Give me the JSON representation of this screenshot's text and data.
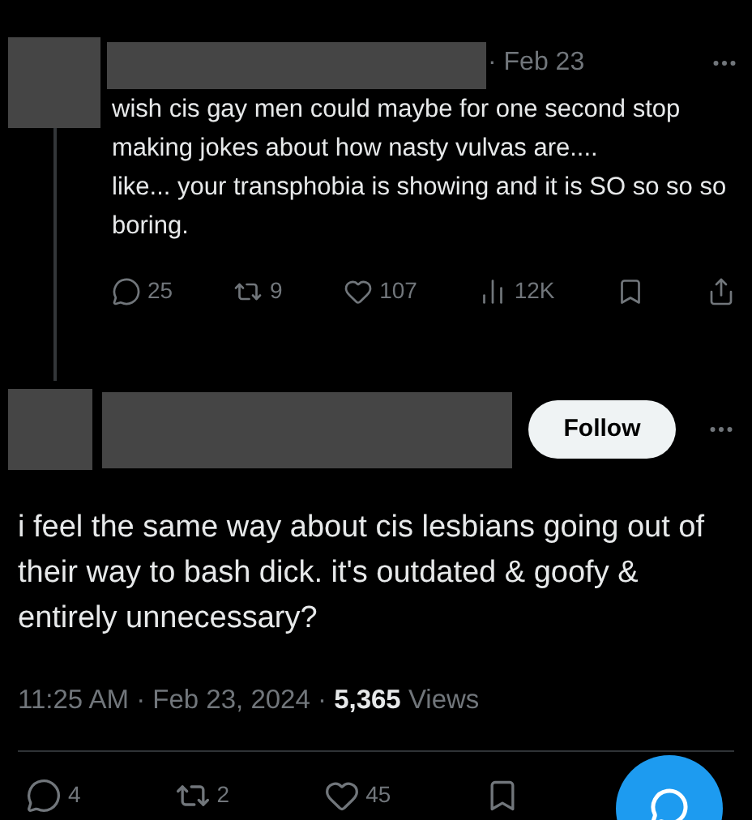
{
  "parent_post": {
    "date": "· Feb 23",
    "text": "wish cis gay men could maybe for one second stop making jokes about how nasty vulvas are....\nlike... your transphobia is showing and it is SO so so so boring.",
    "actions": [
      {
        "kind": "reply",
        "count": "25"
      },
      {
        "kind": "repost",
        "count": "9"
      },
      {
        "kind": "like",
        "count": "107"
      },
      {
        "kind": "views",
        "count": "12K"
      },
      {
        "kind": "bookmark"
      },
      {
        "kind": "share"
      }
    ]
  },
  "main_post": {
    "follow_button": "Follow",
    "text": "i feel the same way about cis lesbians going out of their way to bash dick. it's outdated & goofy & entirely unnecessary?",
    "meta": "11:25 AM · Feb 23, 2024 · **5,365** Views",
    "actions": [
      {
        "kind": "reply",
        "count": "4"
      },
      {
        "kind": "repost",
        "count": "2"
      },
      {
        "kind": "like",
        "count": "45"
      },
      {
        "kind": "bookmark"
      }
    ]
  }
}
